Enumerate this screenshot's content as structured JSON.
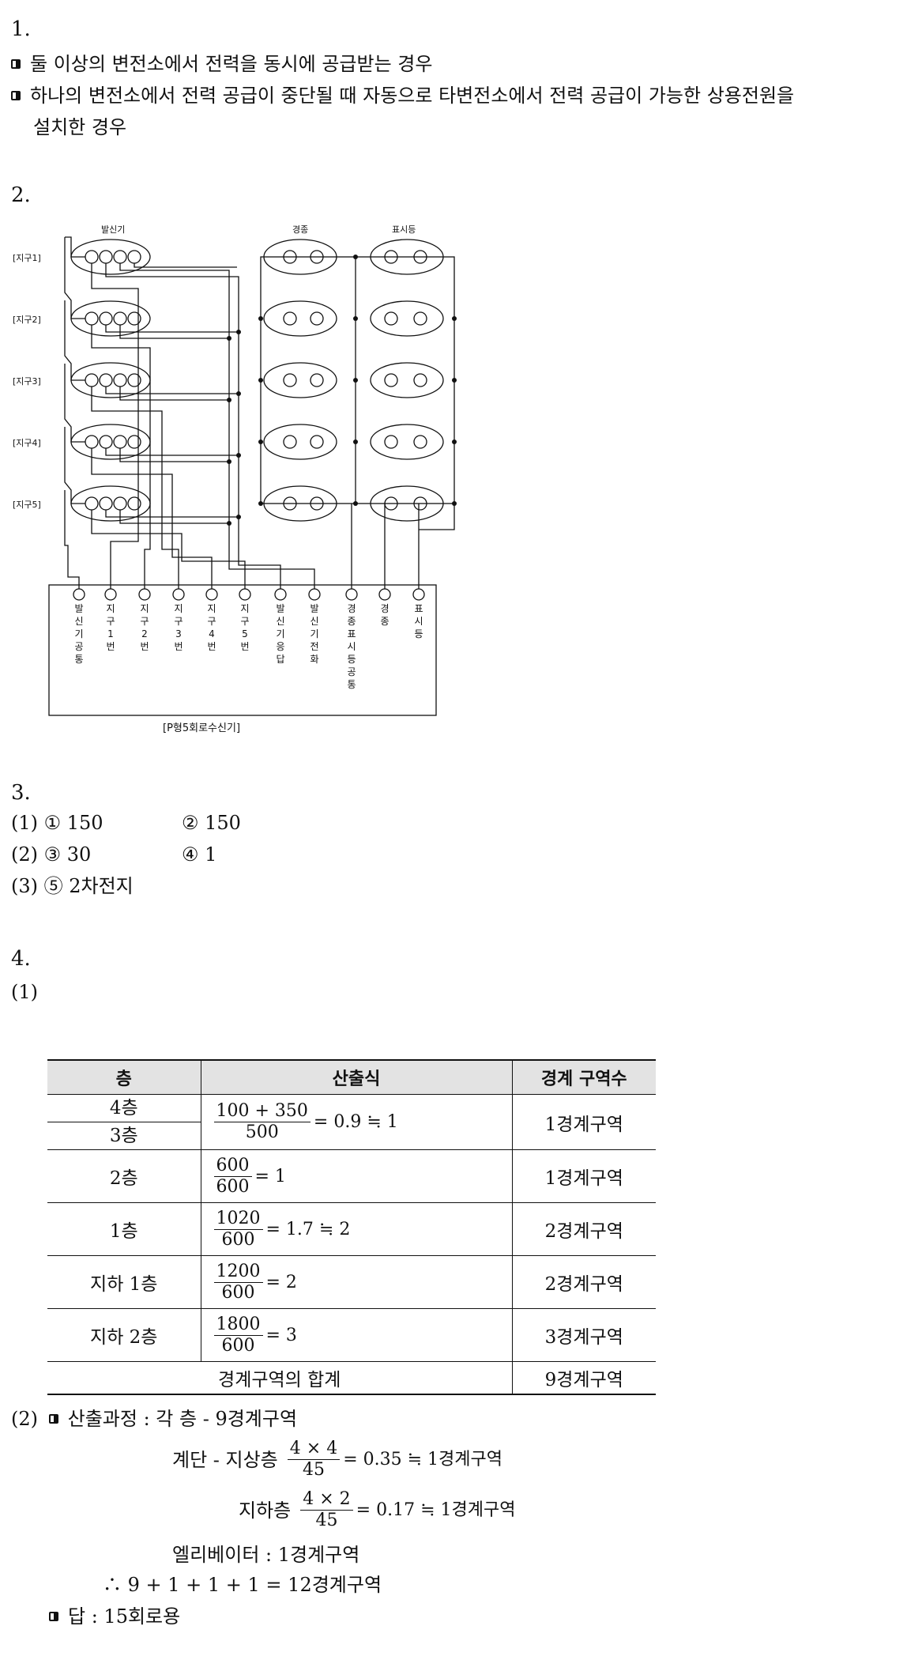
{
  "q1": {
    "number": "1.",
    "bullets": [
      "둘 이상의 변전소에서 전력을 동시에 공급받는 경우",
      "하나의 변전소에서 전력 공급이 중단될 때 자동으로 타변전소에서 전력 공급이 가능한 상용전원을",
      "설치한 경우"
    ]
  },
  "q2": {
    "number": "2.",
    "diagram": {
      "label_top_left": "발신기",
      "label_top_mid": "경종",
      "label_top_right": "표시등",
      "zones": [
        "[지구1]",
        "[지구2]",
        "[지구3]",
        "[지구4]",
        "[지구5]"
      ],
      "terminals": [
        "발신기공통",
        "지구1번",
        "지구2번",
        "지구3번",
        "지구4번",
        "지구5번",
        "발신기응답",
        "발신기전화",
        "경종표시등공통",
        "경종",
        "표시등"
      ],
      "caption": "[P형5회로수신기]"
    }
  },
  "q3": {
    "number": "3.",
    "lines": [
      {
        "a": "(1) ① 150",
        "b": "② 150"
      },
      {
        "a": "(2) ③ 30",
        "b": "④ 1"
      },
      {
        "a": "(3) ⑤ 2차전지",
        "b": ""
      }
    ]
  },
  "q4": {
    "number": "4.",
    "sub1": "(1)",
    "table": {
      "headers": [
        "층",
        "산출식",
        "경계 구역수"
      ],
      "rows": [
        {
          "floor_a": "4층",
          "floor_b": "3층",
          "num": "100 + 350",
          "den": "500",
          "result": "= 0.9 ≒ 1",
          "zones": "1경계구역"
        },
        {
          "floor": "2층",
          "num": "600",
          "den": "600",
          "result": "= 1",
          "zones": "1경계구역"
        },
        {
          "floor": "1층",
          "num": "1020",
          "den": "600",
          "result": "= 1.7 ≒ 2",
          "zones": "2경계구역"
        },
        {
          "floor": "지하 1층",
          "num": "1200",
          "den": "600",
          "result": "= 2",
          "zones": "2경계구역"
        },
        {
          "floor": "지하 2층",
          "num": "1800",
          "den": "600",
          "result": "= 3",
          "zones": "3경계구역"
        }
      ],
      "total_label": "경계구역의 합계",
      "total_value": "9경계구역"
    },
    "sub2": "(2)",
    "calc_label": "산출과정 : 각 층 - 9경계구역",
    "stair_label": "계단 - 지상층",
    "stair_num": "4 × 4",
    "stair_den": "45",
    "stair_result": "= 0.35 ≒ 1경계구역",
    "under_label": "지하층",
    "under_num": "4 × 2",
    "under_den": "45",
    "under_result": "= 0.17 ≒ 1경계구역",
    "elevator": "엘리베이터 : 1경계구역",
    "sum": "∴ 9 + 1 + 1 + 1 = 12경계구역",
    "answer": "답 : 15회로용"
  }
}
